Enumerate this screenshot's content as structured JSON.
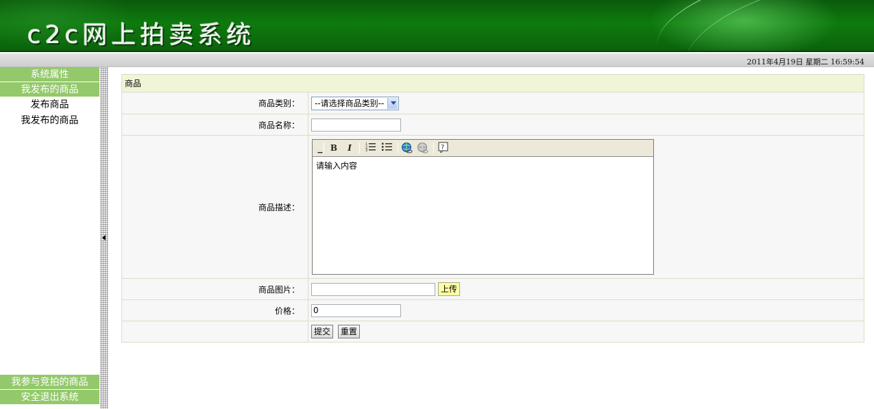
{
  "banner": {
    "title": "c2c网上拍卖系统"
  },
  "statusbar": {
    "datetime": "2011年4月19日  星期二  16:59:54"
  },
  "sidebar": {
    "top_items": [
      {
        "label": "系统属性",
        "type": "header"
      },
      {
        "label": "我发布的商品",
        "type": "header"
      },
      {
        "label": "发布商品",
        "type": "sub"
      },
      {
        "label": "我发布的商品",
        "type": "sub"
      }
    ],
    "bottom_items": [
      {
        "label": "我参与竞拍的商品"
      },
      {
        "label": "安全退出系统"
      }
    ]
  },
  "form": {
    "section_title": "商品",
    "category": {
      "label": "商品类别：",
      "selected": "--请选择商品类别--"
    },
    "name": {
      "label": "商品名称：",
      "value": ""
    },
    "description": {
      "label": "商品描述：",
      "content": "请输入内容",
      "toolbar": [
        "B",
        "I",
        "numbered-list",
        "bulleted-list",
        "insert-link",
        "remove-link",
        "help"
      ]
    },
    "image": {
      "label": "商品图片：",
      "value": "",
      "upload_label": "上传"
    },
    "price": {
      "label": "价格：",
      "value": "0"
    },
    "submit_label": "提交",
    "reset_label": "重置"
  },
  "colors": {
    "banner_green": "#0e7a0e",
    "nav_header_green": "#93c96b",
    "section_header_bg": "#f1f5d8"
  }
}
